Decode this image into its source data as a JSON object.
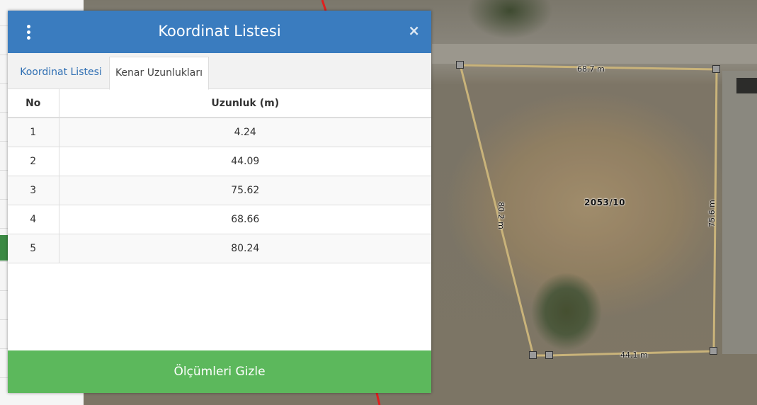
{
  "panel": {
    "title": "Koordinat Listesi",
    "close_icon": "×"
  },
  "tabs": [
    {
      "label": "Koordinat Listesi",
      "active": false
    },
    {
      "label": "Kenar Uzunlukları",
      "active": true
    }
  ],
  "table": {
    "headers": [
      "No",
      "Uzunluk (m)"
    ],
    "rows": [
      {
        "no": "1",
        "length": "4.24"
      },
      {
        "no": "2",
        "length": "44.09"
      },
      {
        "no": "3",
        "length": "75.62"
      },
      {
        "no": "4",
        "length": "68.66"
      },
      {
        "no": "5",
        "length": "80.24"
      }
    ]
  },
  "hide_button": "Ölçümleri Gizle",
  "map": {
    "parcel_label": "2053/10",
    "edge_labels": {
      "top": "68.7 m",
      "left": "80.2 m",
      "right": "75.6 m",
      "bottom": "44.1 m"
    },
    "parcel_color": "#c9b37a",
    "boundary_color": "#e0201e"
  }
}
